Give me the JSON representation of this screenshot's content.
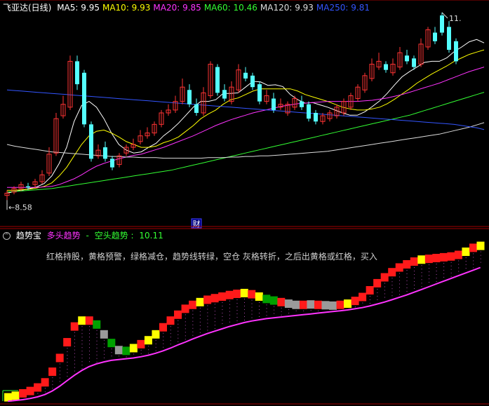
{
  "main_panel": {
    "title": "飞亚达(日线)",
    "ma_labels": [
      {
        "name": "MA5",
        "text": "MA5: 9.95",
        "color": "#ffffff"
      },
      {
        "name": "MA10",
        "text": "MA10: 9.93",
        "color": "#ffff00"
      },
      {
        "name": "MA20",
        "text": "MA20: 9.85",
        "color": "#ff33ff"
      },
      {
        "name": "MA60",
        "text": "MA60: 10.46",
        "color": "#33ff33"
      },
      {
        "name": "MA120",
        "text": "MA120: 9.93",
        "color": "#dddddd"
      },
      {
        "name": "MA250",
        "text": "MA250: 9.81",
        "color": "#3355ff"
      }
    ],
    "low_label": "8.58",
    "high_label": "11.",
    "cai_marker": "财"
  },
  "sub_panel": {
    "title": "趋势宝",
    "bull_label": "多头趋势",
    "sep": "-",
    "bear_label": "空头趋势",
    "value": "10.11",
    "note": "红格持股，黄格预警，绿格减仓，趋势线转绿，空仓    灰格转折，之后出黄格或红格，买入"
  },
  "chart_data": [
    {
      "type": "candlestick",
      "title": "飞亚达(日线)",
      "up_color": "#ff3333",
      "down_color": "#54ffff",
      "ylim": [
        8.4,
        11.8
      ],
      "x": [
        1,
        2,
        3,
        4,
        5,
        6,
        7,
        8,
        9,
        10,
        11,
        12,
        13,
        14,
        15,
        16,
        17,
        18,
        19,
        20,
        21,
        22,
        23,
        24,
        25,
        26,
        27,
        28,
        29,
        30,
        31,
        32,
        33,
        34,
        35,
        36,
        37,
        38,
        39,
        40,
        41,
        42,
        43,
        44,
        45,
        46,
        47,
        48,
        49,
        50,
        51,
        52,
        53,
        54,
        55,
        56,
        57,
        58,
        59,
        60,
        61,
        62,
        63,
        64,
        65,
        66,
        67,
        68,
        69
      ],
      "open": [
        8.66,
        8.72,
        8.78,
        8.82,
        8.85,
        8.9,
        9.05,
        9.4,
        10.05,
        10.2,
        11.0,
        10.8,
        9.9,
        9.35,
        9.5,
        9.3,
        9.2,
        9.4,
        9.5,
        9.6,
        9.7,
        9.75,
        9.9,
        10.1,
        10.15,
        10.3,
        10.5,
        10.25,
        10.1,
        10.4,
        10.9,
        10.5,
        10.3,
        10.5,
        10.8,
        10.75,
        10.6,
        10.3,
        10.35,
        10.2,
        10.1,
        10.2,
        10.3,
        10.25,
        10.1,
        9.95,
        10.0,
        10.05,
        10.1,
        10.2,
        10.35,
        10.5,
        10.7,
        10.9,
        10.95,
        10.8,
        10.9,
        11.1,
        11.05,
        10.95,
        11.25,
        11.5,
        11.8,
        11.6,
        11.35
      ],
      "close": [
        8.7,
        8.78,
        8.85,
        8.8,
        8.9,
        9.02,
        9.38,
        10.0,
        10.25,
        11.0,
        10.6,
        9.9,
        9.3,
        9.45,
        9.3,
        9.15,
        9.35,
        9.5,
        9.55,
        9.7,
        9.75,
        9.9,
        10.1,
        10.15,
        10.3,
        10.55,
        10.25,
        10.1,
        10.45,
        10.95,
        10.45,
        10.35,
        10.55,
        10.85,
        10.7,
        10.55,
        10.3,
        10.4,
        10.15,
        10.25,
        10.25,
        10.35,
        10.2,
        10.0,
        9.95,
        10.05,
        10.1,
        10.2,
        10.3,
        10.4,
        10.55,
        10.75,
        10.95,
        11.0,
        10.85,
        10.95,
        11.15,
        11.0,
        10.9,
        11.3,
        11.55,
        11.35,
        11.5,
        11.2,
        11.0
      ],
      "high": [
        8.75,
        8.82,
        8.9,
        8.88,
        8.95,
        9.1,
        9.5,
        10.1,
        10.4,
        11.1,
        11.1,
        10.85,
        9.95,
        9.55,
        9.6,
        9.35,
        9.4,
        9.55,
        9.65,
        9.8,
        9.85,
        9.95,
        10.15,
        10.25,
        10.4,
        10.7,
        10.6,
        10.35,
        10.55,
        11.0,
        10.95,
        10.6,
        10.65,
        10.95,
        10.9,
        10.8,
        10.65,
        10.5,
        10.45,
        10.35,
        10.3,
        10.4,
        10.4,
        10.3,
        10.15,
        10.1,
        10.15,
        10.25,
        10.35,
        10.45,
        10.6,
        10.8,
        11.05,
        11.15,
        11.0,
        11.05,
        11.25,
        11.2,
        11.1,
        11.4,
        11.6,
        11.6,
        11.85,
        11.7,
        11.4
      ],
      "low": [
        8.58,
        8.68,
        8.74,
        8.76,
        8.8,
        8.86,
        9.0,
        9.35,
        10.0,
        10.15,
        10.5,
        9.85,
        9.25,
        9.3,
        9.25,
        9.1,
        9.15,
        9.35,
        9.45,
        9.55,
        9.65,
        9.7,
        9.85,
        10.05,
        10.1,
        10.25,
        10.2,
        10.05,
        10.05,
        10.35,
        10.4,
        10.3,
        10.25,
        10.45,
        10.65,
        10.5,
        10.25,
        10.25,
        10.1,
        10.15,
        10.05,
        10.15,
        10.15,
        9.95,
        9.9,
        9.9,
        9.95,
        10.0,
        10.05,
        10.15,
        10.3,
        10.45,
        10.65,
        10.85,
        10.8,
        10.75,
        10.85,
        10.95,
        10.85,
        10.9,
        11.2,
        11.3,
        11.45,
        11.15,
        10.95
      ],
      "series": [
        {
          "name": "MA5",
          "color": "#ffffff",
          "values": [
            8.7,
            8.73,
            8.75,
            8.78,
            8.81,
            8.87,
            9.0,
            9.22,
            9.5,
            9.95,
            10.23,
            10.3,
            10.2,
            10.0,
            9.75,
            9.55,
            9.45,
            9.4,
            9.42,
            9.5,
            9.57,
            9.7,
            9.8,
            9.92,
            10.06,
            10.2,
            10.3,
            10.3,
            10.33,
            10.44,
            10.44,
            10.45,
            10.55,
            10.65,
            10.64,
            10.58,
            10.59,
            10.56,
            10.42,
            10.33,
            10.27,
            10.28,
            10.24,
            10.2,
            10.15,
            10.1,
            10.06,
            10.06,
            10.12,
            10.21,
            10.31,
            10.44,
            10.59,
            10.73,
            10.82,
            10.9,
            10.98,
            11.0,
            11.0,
            11.06,
            11.17,
            11.25,
            11.34,
            11.38,
            11.32
          ]
        },
        {
          "name": "MA10",
          "color": "#ffff00",
          "values": [
            8.75,
            8.75,
            8.76,
            8.77,
            8.79,
            8.82,
            8.88,
            9.0,
            9.15,
            9.35,
            9.55,
            9.7,
            9.78,
            9.8,
            9.75,
            9.68,
            9.6,
            9.55,
            9.5,
            9.5,
            9.52,
            9.58,
            9.62,
            9.68,
            9.78,
            9.88,
            10.0,
            10.08,
            10.15,
            10.25,
            10.33,
            10.36,
            10.42,
            10.48,
            10.52,
            10.52,
            10.52,
            10.52,
            10.52,
            10.48,
            10.42,
            10.38,
            10.34,
            10.3,
            10.25,
            10.2,
            10.17,
            10.15,
            10.15,
            10.17,
            10.2,
            10.26,
            10.34,
            10.43,
            10.52,
            10.62,
            10.7,
            10.78,
            10.85,
            10.92,
            11.0,
            11.06,
            11.12,
            11.16,
            11.2
          ]
        },
        {
          "name": "MA20",
          "color": "#ff33ff",
          "values": [
            8.8,
            8.8,
            8.8,
            8.8,
            8.8,
            8.81,
            8.82,
            8.85,
            8.9,
            8.95,
            9.02,
            9.1,
            9.17,
            9.22,
            9.26,
            9.3,
            9.33,
            9.36,
            9.38,
            9.42,
            9.46,
            9.5,
            9.55,
            9.6,
            9.65,
            9.7,
            9.76,
            9.82,
            9.88,
            9.93,
            9.98,
            10.02,
            10.06,
            10.1,
            10.13,
            10.16,
            10.19,
            10.22,
            10.24,
            10.26,
            10.27,
            10.28,
            10.29,
            10.3,
            10.3,
            10.3,
            10.3,
            10.3,
            10.31,
            10.32,
            10.34,
            10.36,
            10.39,
            10.42,
            10.46,
            10.5,
            10.54,
            10.58,
            10.62,
            10.67,
            10.72,
            10.77,
            10.82,
            10.86,
            10.9
          ]
        },
        {
          "name": "MA60",
          "color": "#33ff33",
          "values": [
            8.72,
            8.73,
            8.74,
            8.75,
            8.76,
            8.77,
            8.78,
            8.8,
            8.82,
            8.84,
            8.86,
            8.88,
            8.9,
            8.92,
            8.94,
            8.96,
            8.98,
            9.0,
            9.02,
            9.04,
            9.06,
            9.08,
            9.1,
            9.13,
            9.16,
            9.19,
            9.22,
            9.25,
            9.28,
            9.31,
            9.34,
            9.37,
            9.4,
            9.43,
            9.46,
            9.49,
            9.52,
            9.55,
            9.58,
            9.61,
            9.64,
            9.67,
            9.7,
            9.73,
            9.76,
            9.79,
            9.82,
            9.85,
            9.88,
            9.91,
            9.94,
            9.97,
            10.0,
            10.03,
            10.06,
            10.1,
            10.14,
            10.18,
            10.22,
            10.26,
            10.3,
            10.34,
            10.38,
            10.42,
            10.46
          ]
        },
        {
          "name": "MA120",
          "color": "#dddddd",
          "values": [
            9.55,
            9.52,
            9.5,
            9.48,
            9.46,
            9.44,
            9.42,
            9.41,
            9.4,
            9.39,
            9.38,
            9.37,
            9.36,
            9.35,
            9.34,
            9.34,
            9.33,
            9.33,
            9.32,
            9.32,
            9.32,
            9.31,
            9.31,
            9.31,
            9.31,
            9.31,
            9.31,
            9.32,
            9.32,
            9.32,
            9.33,
            9.33,
            9.34,
            9.34,
            9.35,
            9.35,
            9.36,
            9.37,
            9.38,
            9.39,
            9.4,
            9.41,
            9.42,
            9.43,
            9.45,
            9.47,
            9.49,
            9.51,
            9.53,
            9.55,
            9.57,
            9.59,
            9.61,
            9.63,
            9.65,
            9.67,
            9.69,
            9.71,
            9.73,
            9.76,
            9.79,
            9.82,
            9.85,
            9.89,
            9.93
          ]
        },
        {
          "name": "MA250",
          "color": "#3355ff",
          "values": [
            10.5,
            10.49,
            10.48,
            10.47,
            10.46,
            10.45,
            10.44,
            10.43,
            10.42,
            10.41,
            10.4,
            10.39,
            10.38,
            10.37,
            10.36,
            10.35,
            10.34,
            10.33,
            10.32,
            10.31,
            10.3,
            10.29,
            10.28,
            10.27,
            10.26,
            10.25,
            10.24,
            10.23,
            10.22,
            10.21,
            10.2,
            10.19,
            10.18,
            10.17,
            10.16,
            10.15,
            10.14,
            10.13,
            10.12,
            10.11,
            10.1,
            10.09,
            10.08,
            10.07,
            10.06,
            10.05,
            10.04,
            10.03,
            10.02,
            10.01,
            10.0,
            9.99,
            9.98,
            9.97,
            9.96,
            9.95,
            9.94,
            9.93,
            9.92,
            9.91,
            9.9,
            9.88,
            9.86,
            9.84,
            9.81
          ]
        }
      ]
    },
    {
      "type": "step",
      "title": "趋势宝",
      "ylim": [
        8.4,
        11.8
      ],
      "color_legend": {
        "R": "#ff1a1a",
        "Y": "#ffff00",
        "G": "#00a000",
        "H": "#9a9a9a"
      },
      "x": [
        1,
        2,
        3,
        4,
        5,
        6,
        7,
        8,
        9,
        10,
        11,
        12,
        13,
        14,
        15,
        16,
        17,
        18,
        19,
        20,
        21,
        22,
        23,
        24,
        25,
        26,
        27,
        28,
        29,
        30,
        31,
        32,
        33,
        34,
        35,
        36,
        37,
        38,
        39,
        40,
        41,
        42,
        43,
        44,
        45,
        46,
        47,
        48,
        49,
        50,
        51,
        52,
        53,
        54,
        55,
        56,
        57,
        58,
        59,
        60,
        61,
        62,
        63,
        64,
        65
      ],
      "values": [
        8.6,
        8.64,
        8.7,
        8.76,
        8.85,
        8.98,
        9.25,
        9.6,
        10.0,
        10.4,
        10.55,
        10.55,
        10.45,
        10.2,
        9.98,
        9.8,
        9.78,
        9.85,
        9.95,
        10.05,
        10.2,
        10.38,
        10.55,
        10.7,
        10.85,
        10.95,
        11.02,
        11.08,
        11.12,
        11.16,
        11.2,
        11.23,
        11.25,
        11.22,
        11.16,
        11.1,
        11.06,
        11.02,
        10.98,
        10.95,
        10.95,
        10.96,
        10.95,
        10.94,
        10.93,
        10.95,
        10.98,
        11.05,
        11.15,
        11.32,
        11.5,
        11.65,
        11.78,
        11.9,
        11.98,
        12.05,
        12.1,
        12.12,
        12.14,
        12.16,
        12.18,
        12.22,
        12.3,
        12.4,
        12.45
      ],
      "colors": [
        "Y",
        "Y",
        "R",
        "R",
        "R",
        "R",
        "R",
        "R",
        "R",
        "R",
        "Y",
        "R",
        "G",
        "H",
        "G",
        "H",
        "G",
        "Y",
        "R",
        "Y",
        "Y",
        "R",
        "R",
        "R",
        "R",
        "R",
        "Y",
        "R",
        "R",
        "R",
        "R",
        "R",
        "Y",
        "R",
        "Y",
        "G",
        "G",
        "R",
        "H",
        "H",
        "R",
        "H",
        "R",
        "H",
        "H",
        "R",
        "Y",
        "R",
        "R",
        "R",
        "R",
        "R",
        "R",
        "R",
        "R",
        "R",
        "Y",
        "R",
        "R",
        "R",
        "R",
        "R",
        "Y",
        "R",
        "Y"
      ],
      "series": [
        {
          "name": "趋势线",
          "color": "#ff33ff",
          "values": [
            8.5,
            8.52,
            8.54,
            8.57,
            8.61,
            8.67,
            8.76,
            8.88,
            9.02,
            9.16,
            9.28,
            9.38,
            9.45,
            9.5,
            9.54,
            9.56,
            9.58,
            9.6,
            9.63,
            9.67,
            9.72,
            9.78,
            9.85,
            9.93,
            10.0,
            10.08,
            10.15,
            10.22,
            10.28,
            10.34,
            10.4,
            10.45,
            10.5,
            10.54,
            10.57,
            10.6,
            10.62,
            10.64,
            10.66,
            10.68,
            10.7,
            10.72,
            10.74,
            10.76,
            10.78,
            10.8,
            10.82,
            10.85,
            10.88,
            10.92,
            10.97,
            11.02,
            11.08,
            11.14,
            11.2,
            11.27,
            11.34,
            11.41,
            11.48,
            11.55,
            11.62,
            11.69,
            11.76,
            11.83,
            11.9
          ]
        }
      ]
    }
  ]
}
